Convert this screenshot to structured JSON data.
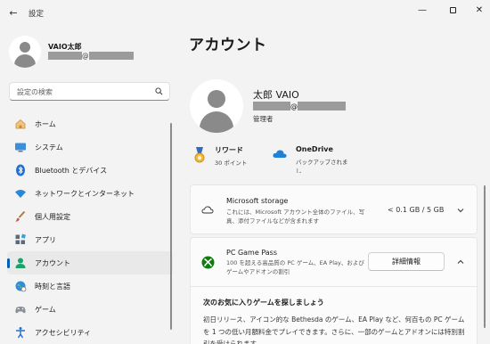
{
  "window": {
    "title": "設定",
    "back_glyph": "←",
    "minimize_glyph": "—",
    "close_glyph": "✕"
  },
  "sidebar": {
    "user": {
      "name": "VAIO太郎",
      "email_at": "@"
    },
    "search": {
      "placeholder": "設定の検索"
    },
    "items": [
      {
        "label": "ホーム",
        "icon": "home-icon"
      },
      {
        "label": "システム",
        "icon": "system-icon"
      },
      {
        "label": "Bluetooth とデバイス",
        "icon": "bluetooth-icon"
      },
      {
        "label": "ネットワークとインターネット",
        "icon": "wifi-icon"
      },
      {
        "label": "個人用設定",
        "icon": "brush-icon"
      },
      {
        "label": "アプリ",
        "icon": "apps-icon"
      },
      {
        "label": "アカウント",
        "icon": "account-icon",
        "active": true
      },
      {
        "label": "時刻と言語",
        "icon": "globe-icon"
      },
      {
        "label": "ゲーム",
        "icon": "gamepad-icon"
      },
      {
        "label": "アクセシビリティ",
        "icon": "accessibility-icon"
      }
    ]
  },
  "main": {
    "title": "アカウント",
    "profile": {
      "name": "太郎 VAIO",
      "email_at": "@",
      "role": "管理者"
    },
    "rewards": {
      "title": "リワード",
      "points": "30 ポイント"
    },
    "onedrive": {
      "title": "OneDrive",
      "subtitle": "バックアップされま し"
    },
    "storage": {
      "title": "Microsoft storage",
      "desc": "これには、Microsoft アカウント全体のファイル、写真、添付ファイルなどが含まれます",
      "value": "< 0.1 GB / 5 GB"
    },
    "gamepass": {
      "title": "PC Game Pass",
      "desc": "100 を超える高品質の PC ゲーム、EA Play、および ゲームやアドオンの割引",
      "details_label": "詳細情報",
      "expanded_title": "次のお気に入りゲームを探しましょう",
      "expanded_body": "初日リリース、アイコン的な Bethesda のゲーム、EA Play など、何百もの PC ゲームを 1 つの低い月額料金でプレイできます。さらに、一部のゲームとアドオンには特別割引を受けられます"
    }
  },
  "colors": {
    "accent": "#005fb8",
    "background": "#f3f3f3",
    "card": "#fbfbfb"
  }
}
